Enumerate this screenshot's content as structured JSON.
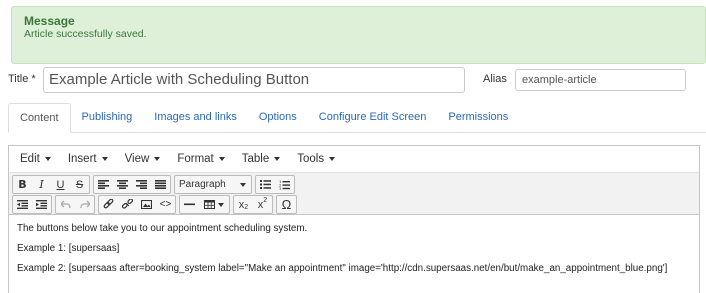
{
  "message": {
    "heading": "Message",
    "text": "Article successfully saved."
  },
  "form": {
    "title_label": "Title *",
    "title_value": "Example Article with Scheduling Button",
    "alias_label": "Alias",
    "alias_value": "example-article"
  },
  "tabs": [
    {
      "label": "Content",
      "active": true
    },
    {
      "label": "Publishing"
    },
    {
      "label": "Images and links"
    },
    {
      "label": "Options"
    },
    {
      "label": "Configure Edit Screen"
    },
    {
      "label": "Permissions"
    }
  ],
  "editor": {
    "menus": [
      "Edit",
      "Insert",
      "View",
      "Format",
      "Table",
      "Tools"
    ],
    "format_select": "Paragraph",
    "icons_row1": [
      "bold-icon",
      "italic-icon",
      "underline-icon",
      "strikethrough-icon",
      "align-left-icon",
      "align-center-icon",
      "align-right-icon",
      "align-justify-icon",
      "paragraph-select",
      "bullet-list-icon",
      "numbered-list-icon"
    ],
    "icons_row2": [
      "outdent-icon",
      "indent-icon",
      "undo-icon",
      "redo-icon",
      "link-icon",
      "unlink-icon",
      "image-icon",
      "code-icon",
      "horizontal-rule-icon",
      "table-icon",
      "subscript-icon",
      "superscript-icon",
      "special-char-icon"
    ],
    "content": [
      "The buttons below take you to our appointment scheduling system.",
      "Example 1: [supersaas]",
      "Example 2: [supersaas after=booking_system label=\"Make an appointment\" image='http://cdn.supersaas.net/en/but/make_an_appointment_blue.png']"
    ]
  },
  "colors": {
    "alert_bg": "#dff0d8",
    "alert_text": "#3c763d",
    "link": "#2a69b8"
  }
}
